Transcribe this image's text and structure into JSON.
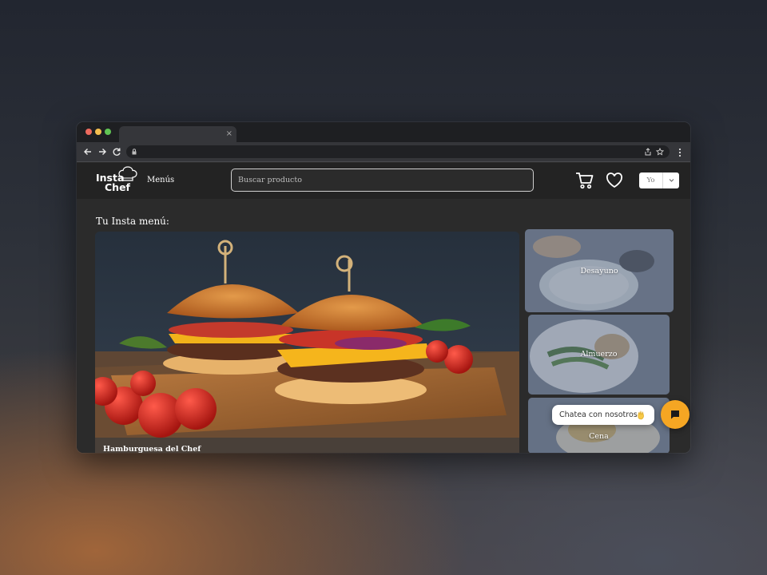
{
  "browser": {
    "tab_close": "×"
  },
  "header": {
    "logo_line1": "Insta",
    "logo_line2": "Chef",
    "menus_label": "Menús",
    "search_placeholder": "Buscar producto",
    "user_label": "Yo"
  },
  "main": {
    "section_title": "Tu Insta menú:",
    "featured": {
      "title": "Hamburguesa del Chef"
    },
    "categories": [
      {
        "label": "Desayuno"
      },
      {
        "label": "Almuerzo"
      },
      {
        "label": "Cena"
      }
    ]
  },
  "chat": {
    "prompt": "Chatea con nosotros",
    "accent_color": "#f5a623"
  },
  "icons": {
    "cart": "cart-icon",
    "favorites": "heart-icon",
    "user_menu": "chevron-down-icon",
    "chat": "chat-icon"
  }
}
